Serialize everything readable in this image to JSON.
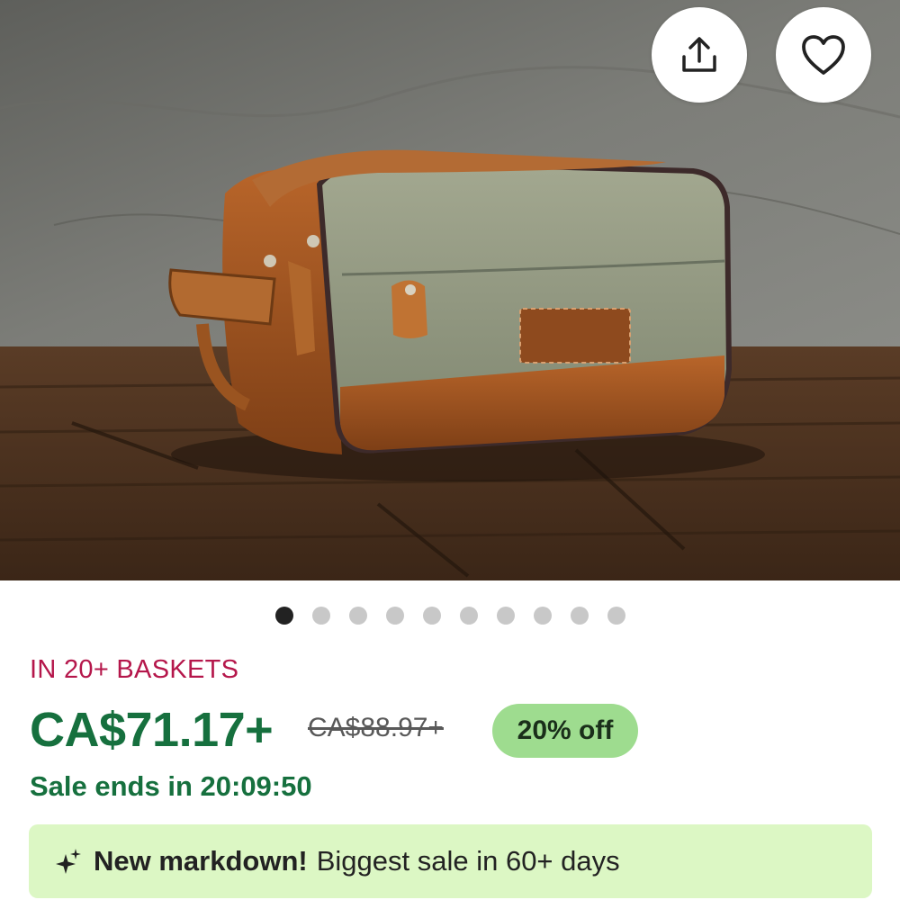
{
  "product": {
    "image_alt": "Canvas and leather toiletry bag",
    "image_count": 10,
    "active_image_index": 0
  },
  "actions": {
    "share_icon": "share-upload-icon",
    "favorite_icon": "heart-outline-icon"
  },
  "listing": {
    "baskets_text": "IN 20+ BASKETS",
    "price": "CA$71.17+",
    "original_price": "CA$88.97+",
    "discount": "20% off",
    "sale_ends": "Sale ends in 20:09:50"
  },
  "banner": {
    "icon": "sparkle-icon",
    "title": "New markdown!",
    "text": "Biggest sale in 60+ days"
  },
  "colors": {
    "price_green": "#16703e",
    "baskets_red": "#b5174b",
    "badge_green": "#9edc8f",
    "banner_bg": "#dcf7c4"
  }
}
